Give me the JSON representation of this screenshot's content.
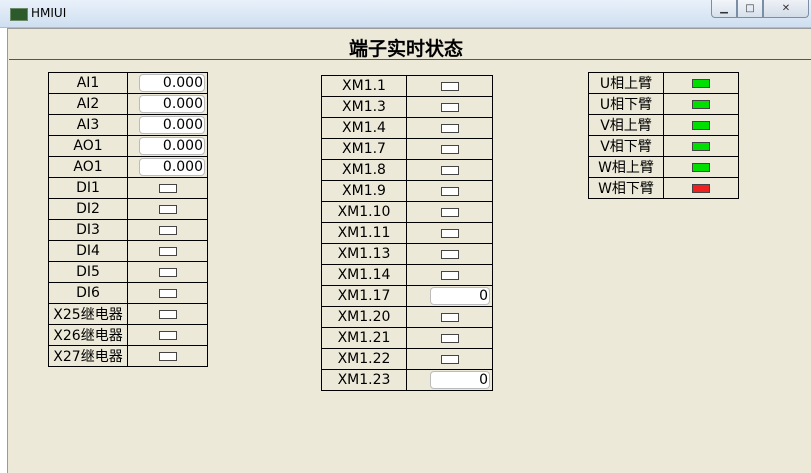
{
  "window": {
    "title": "HMIUI",
    "minimize_symbol": "▁",
    "maximize_symbol": "□",
    "close_symbol": "✕"
  },
  "page": {
    "title": "端子实时状态"
  },
  "left_table": {
    "analog": [
      {
        "label": "AI1",
        "value": "0.000"
      },
      {
        "label": "AI2",
        "value": "0.000"
      },
      {
        "label": "AI3",
        "value": "0.000"
      },
      {
        "label": "AO1",
        "value": "0.000"
      },
      {
        "label": "AO1",
        "value": "0.000"
      }
    ],
    "digital": [
      {
        "label": "DI1"
      },
      {
        "label": "DI2"
      },
      {
        "label": "DI3"
      },
      {
        "label": "DI4"
      },
      {
        "label": "DI5"
      },
      {
        "label": "DI6"
      },
      {
        "label": "X25继电器"
      },
      {
        "label": "X26继电器"
      },
      {
        "label": "X27继电器"
      }
    ]
  },
  "middle_table": {
    "rows": [
      {
        "label": "XM1.1"
      },
      {
        "label": "XM1.3"
      },
      {
        "label": "XM1.4"
      },
      {
        "label": "XM1.7"
      },
      {
        "label": "XM1.8"
      },
      {
        "label": "XM1.9"
      },
      {
        "label": "XM1.10"
      },
      {
        "label": "XM1.11"
      },
      {
        "label": "XM1.13"
      },
      {
        "label": "XM1.14"
      },
      {
        "label": "XM1.17",
        "value": "0"
      },
      {
        "label": "XM1.20"
      },
      {
        "label": "XM1.21"
      },
      {
        "label": "XM1.22"
      },
      {
        "label": "XM1.23",
        "value": "0"
      }
    ]
  },
  "right_table": {
    "rows": [
      {
        "label": "U相上臂",
        "status": "on"
      },
      {
        "label": "U相下臂",
        "status": "on"
      },
      {
        "label": "V相上臂",
        "status": "on"
      },
      {
        "label": "V相下臂",
        "status": "on"
      },
      {
        "label": "W相上臂",
        "status": "on"
      },
      {
        "label": "W相下臂",
        "status": "fault"
      }
    ]
  },
  "colors": {
    "led_on": "#00e000",
    "led_fault": "#ee2020",
    "led_off": "#ffffff",
    "panel_bg": "#ece9d8"
  }
}
